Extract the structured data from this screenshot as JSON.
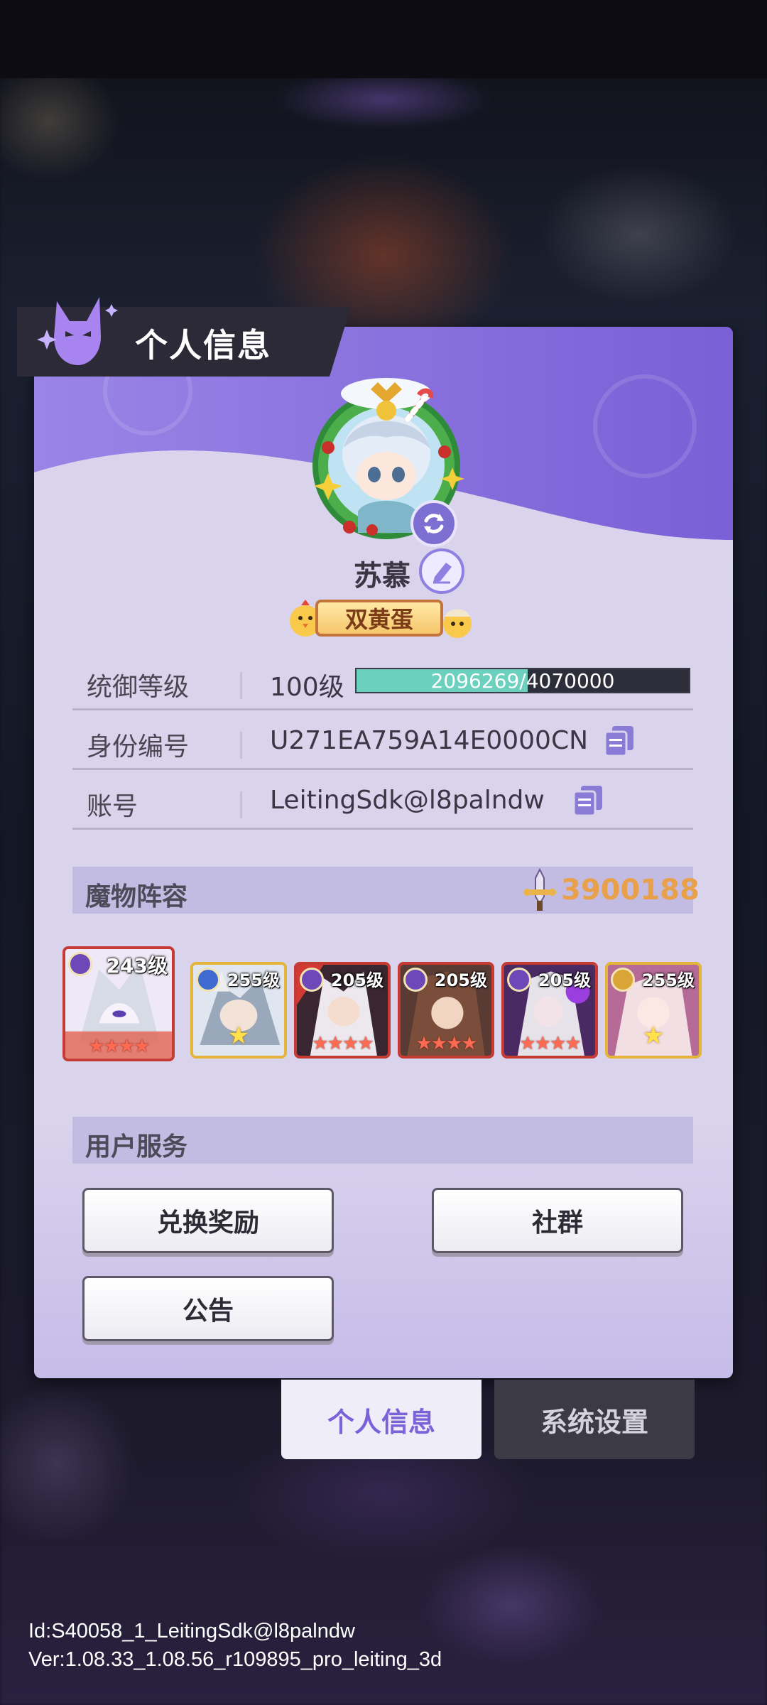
{
  "dialog": {
    "title": "个人信息"
  },
  "profile": {
    "name": "苏慕",
    "title_badge": "双黄蛋"
  },
  "info_rows": [
    {
      "label": "统御等级",
      "value": "100级",
      "exp_text": "2096269/4070000",
      "exp_progress": 0.515
    },
    {
      "label": "身份编号",
      "value": "U271EA759A14E0000CN"
    },
    {
      "label": "账号",
      "value": "LeitingSdk@l8palndw"
    }
  ],
  "lineup": {
    "title": "魔物阵容",
    "power": "3900188",
    "cards": [
      {
        "level": "243级",
        "stars": "★★★★",
        "frame": "#c53b34"
      },
      {
        "level": "255级",
        "stars": "★",
        "frame": "#e3b53a"
      },
      {
        "level": "205级",
        "stars": "★★★★",
        "frame": "#c53b34"
      },
      {
        "level": "205级",
        "stars": "★★★★",
        "frame": "#c53b34"
      },
      {
        "level": "205级",
        "stars": "★★★★",
        "frame": "#c53b34"
      },
      {
        "level": "255级",
        "stars": "★",
        "frame": "#e3b53a"
      }
    ]
  },
  "services": {
    "title": "用户服务",
    "redeem": "兑换奖励",
    "community": "社群",
    "notice": "公告"
  },
  "tabs": {
    "profile": "个人信息",
    "settings": "系统设置"
  },
  "footer": {
    "id_line": "Id:S40058_1_LeitingSdk@l8palndw",
    "version_line": "Ver:1.08.33_1.08.56_r109895_pro_leiting_3d"
  },
  "colors": {
    "accent": "#7a63d8",
    "power": "#e9a04a",
    "exp_fill": "#6bd0bd"
  }
}
